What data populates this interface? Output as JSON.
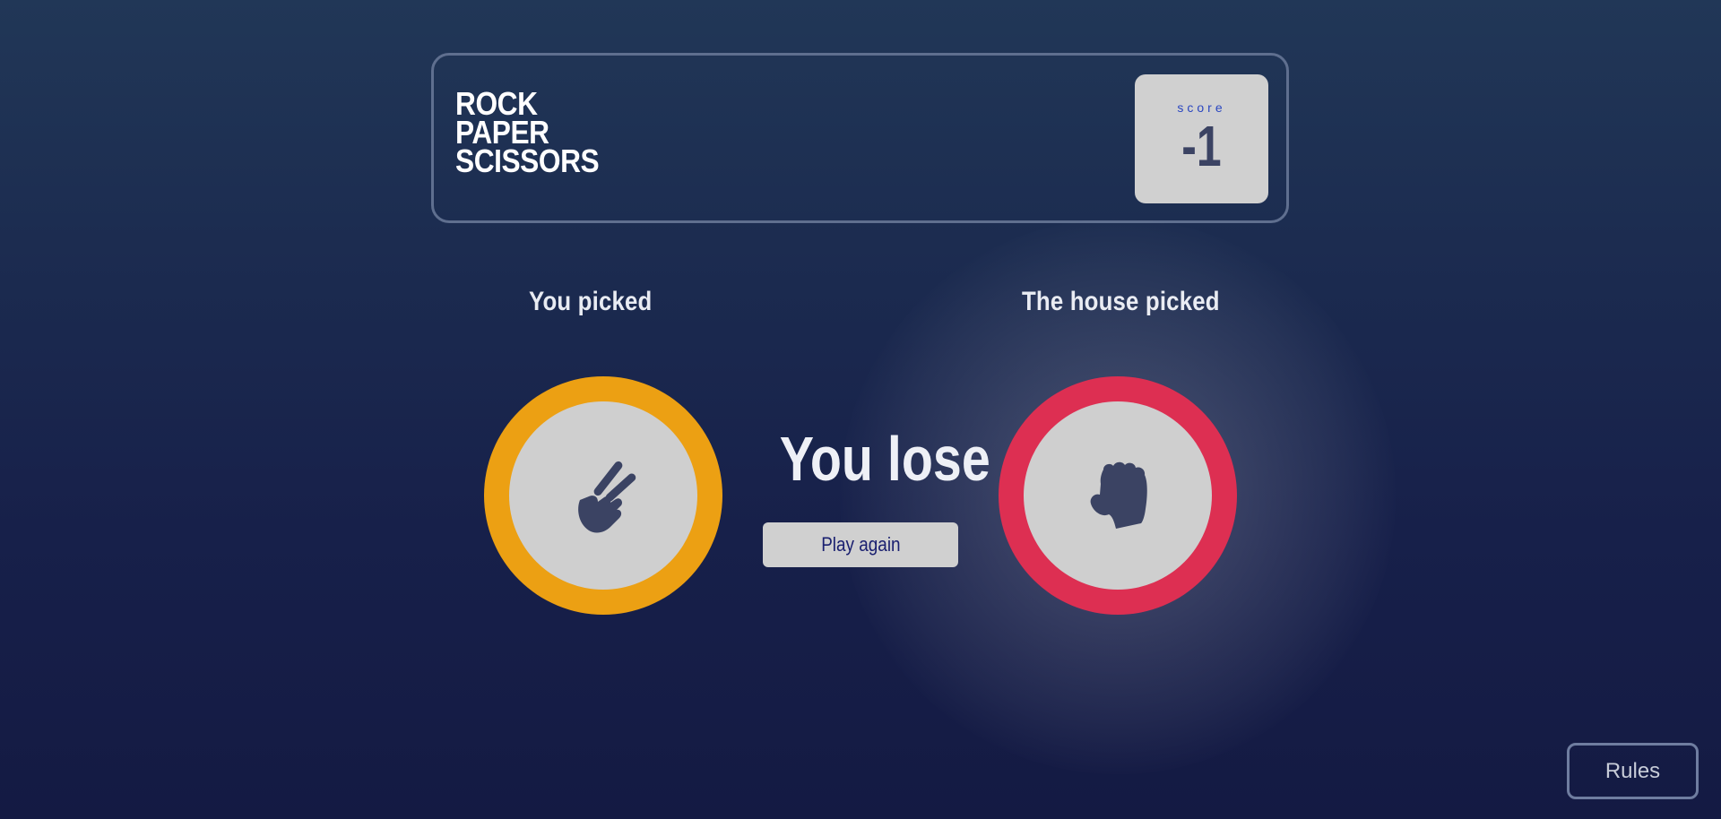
{
  "header": {
    "logo_lines": [
      "ROCK",
      "PAPER",
      "SCISSORS"
    ],
    "score_label": "score",
    "score_value": "-1"
  },
  "game": {
    "player_title": "You picked",
    "house_title": "The house picked",
    "player_pick": {
      "icon": "scissors-hand-icon",
      "ring_color": "#eca013"
    },
    "house_pick": {
      "icon": "rock-fist-icon",
      "ring_color": "#dd2f52"
    },
    "result": "You lose",
    "play_again_label": "Play again"
  },
  "footer": {
    "rules_label": "Rules"
  }
}
